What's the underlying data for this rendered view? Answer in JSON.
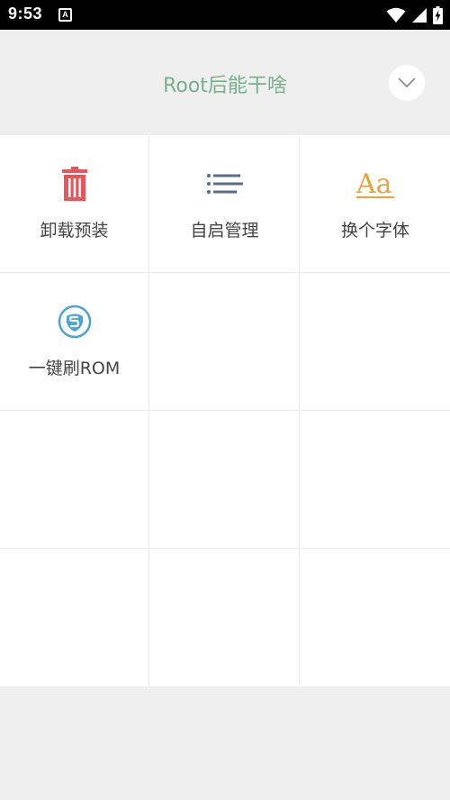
{
  "status_bar": {
    "time": "9:53",
    "notification_icon": "A",
    "icons": [
      "wifi-icon",
      "signal-icon",
      "battery-charging-icon"
    ]
  },
  "header": {
    "title": "Root后能干啥",
    "expand_icon": "chevron-down-icon"
  },
  "colors": {
    "title": "#76b18c",
    "uninstall_icon": "#e8555a",
    "autostart_icon": "#5a6b8c",
    "font_icon": "#e8a33a",
    "rom_icon": "#4aa3d8"
  },
  "grid": {
    "items": [
      {
        "label": "卸载预装",
        "icon": "trash-icon"
      },
      {
        "label": "自启管理",
        "icon": "list-icon"
      },
      {
        "label": "换个字体",
        "icon": "font-icon",
        "icon_text": "Aa"
      },
      {
        "label": "一键刷ROM",
        "icon": "shield-icon"
      }
    ]
  }
}
